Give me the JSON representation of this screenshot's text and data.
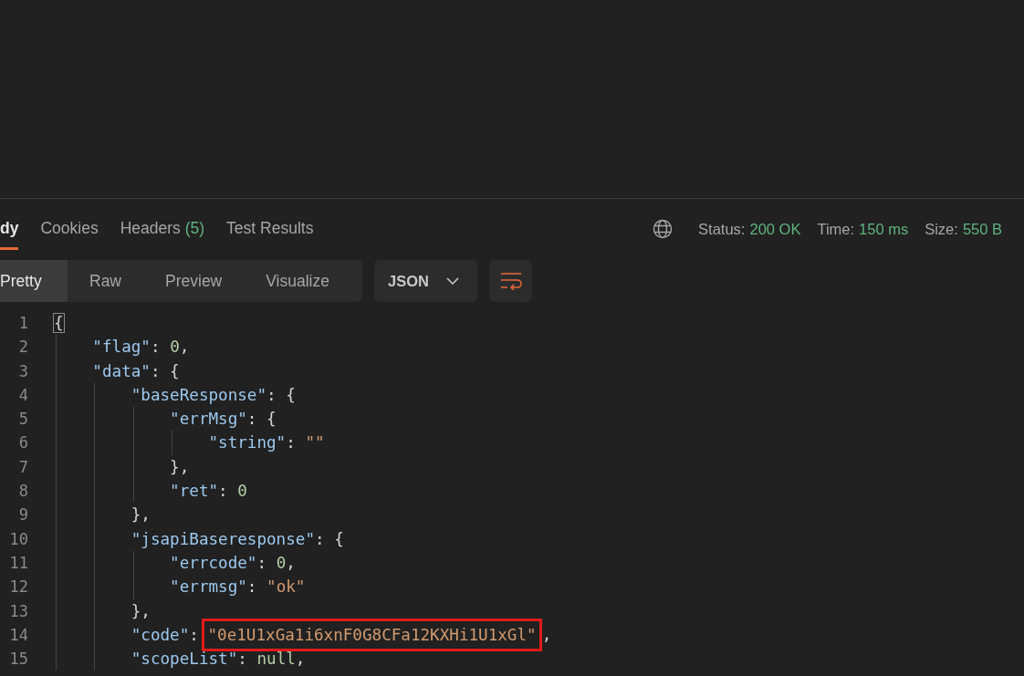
{
  "response_tabs": [
    {
      "label": "dy",
      "selected": true
    },
    {
      "label": "Cookies",
      "selected": false
    },
    {
      "label": "Headers",
      "count": "(5)",
      "selected": false
    },
    {
      "label": "Test Results",
      "selected": false
    }
  ],
  "status": [
    {
      "label": "Status:",
      "value": "200 OK"
    },
    {
      "label": "Time:",
      "value": "150 ms"
    },
    {
      "label": "Size:",
      "value": "550 B"
    }
  ],
  "view_modes": [
    {
      "label": "Pretty",
      "selected": true
    },
    {
      "label": "Raw",
      "selected": false
    },
    {
      "label": "Preview",
      "selected": false
    },
    {
      "label": "Visualize",
      "selected": false
    }
  ],
  "format_dropdown": {
    "value": "JSON"
  },
  "code_lines": [
    {
      "number": "1",
      "tokens": [
        {
          "kind": "brace",
          "text": "{"
        }
      ]
    },
    {
      "number": "2",
      "tokens": [
        {
          "kind": "key",
          "text": "    \"flag\""
        },
        {
          "kind": "punc",
          "text": ": "
        },
        {
          "kind": "number",
          "text": "0"
        },
        {
          "kind": "punc",
          "text": ","
        }
      ]
    },
    {
      "number": "3",
      "tokens": [
        {
          "kind": "key",
          "text": "    \"data\""
        },
        {
          "kind": "punc",
          "text": ": {"
        }
      ]
    },
    {
      "number": "4",
      "tokens": [
        {
          "kind": "key",
          "text": "        \"baseResponse\""
        },
        {
          "kind": "punc",
          "text": ": {"
        }
      ]
    },
    {
      "number": "5",
      "tokens": [
        {
          "kind": "key",
          "text": "            \"errMsg\""
        },
        {
          "kind": "punc",
          "text": ": {"
        }
      ]
    },
    {
      "number": "6",
      "tokens": [
        {
          "kind": "key",
          "text": "                \"string\""
        },
        {
          "kind": "punc",
          "text": ": "
        },
        {
          "kind": "string",
          "text": "\"\""
        }
      ]
    },
    {
      "number": "7",
      "tokens": [
        {
          "kind": "punc",
          "text": "            },"
        }
      ]
    },
    {
      "number": "8",
      "tokens": [
        {
          "kind": "key",
          "text": "            \"ret\""
        },
        {
          "kind": "punc",
          "text": ": "
        },
        {
          "kind": "number",
          "text": "0"
        }
      ]
    },
    {
      "number": "9",
      "tokens": [
        {
          "kind": "punc",
          "text": "        },"
        }
      ]
    },
    {
      "number": "10",
      "tokens": [
        {
          "kind": "key",
          "text": "        \"jsapiBaseresponse\""
        },
        {
          "kind": "punc",
          "text": ": {"
        }
      ]
    },
    {
      "number": "11",
      "tokens": [
        {
          "kind": "key",
          "text": "            \"errcode\""
        },
        {
          "kind": "punc",
          "text": ": "
        },
        {
          "kind": "number",
          "text": "0"
        },
        {
          "kind": "punc",
          "text": ","
        }
      ]
    },
    {
      "number": "12",
      "tokens": [
        {
          "kind": "key",
          "text": "            \"errmsg\""
        },
        {
          "kind": "punc",
          "text": ": "
        },
        {
          "kind": "string",
          "text": "\"ok\""
        }
      ]
    },
    {
      "number": "13",
      "tokens": [
        {
          "kind": "punc",
          "text": "        },"
        }
      ]
    },
    {
      "number": "14",
      "tokens": [
        {
          "kind": "key",
          "text": "        \"code\""
        },
        {
          "kind": "punc",
          "text": ": "
        },
        {
          "kind": "string",
          "text": "\"0e1U1xGa1i6xnF0G8CFa12KXHi1U1xGl\"",
          "highlighted": true
        },
        {
          "kind": "punc",
          "text": ","
        }
      ]
    },
    {
      "number": "15",
      "tokens": [
        {
          "kind": "key",
          "text": "        \"scopeList\""
        },
        {
          "kind": "punc",
          "text": ": "
        },
        {
          "kind": "null",
          "text": "null"
        },
        {
          "kind": "punc",
          "text": ","
        }
      ]
    }
  ]
}
